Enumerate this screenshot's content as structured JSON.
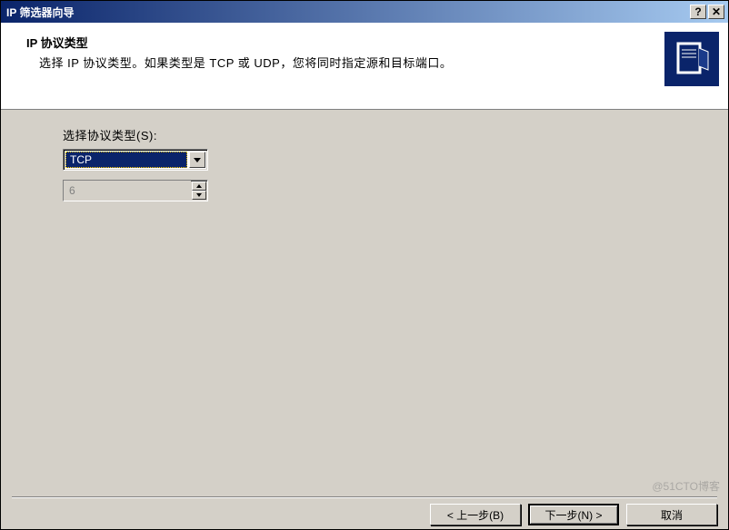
{
  "window": {
    "title": "IP 筛选器向导"
  },
  "header": {
    "title": "IP 协议类型",
    "subtitle": "选择 IP 协议类型。如果类型是 TCP 或 UDP，您将同时指定源和目标端口。"
  },
  "body": {
    "protocol_label": "选择协议类型(S):",
    "protocol_value": "TCP",
    "port_value": "6"
  },
  "footer": {
    "back": "< 上一步(B)",
    "next": "下一步(N) >",
    "cancel": "取消"
  },
  "watermark": "@51CTO博客"
}
